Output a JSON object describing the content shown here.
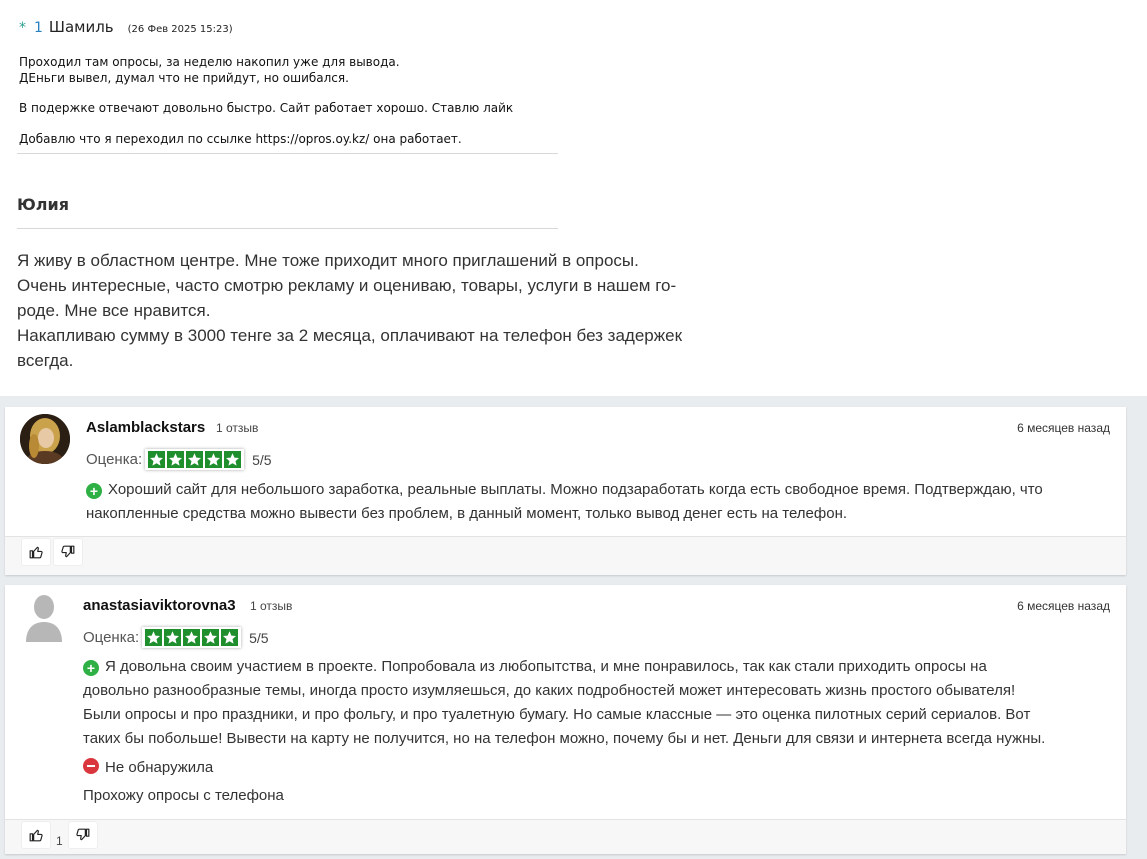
{
  "comment1": {
    "marker": "*",
    "number": "1",
    "author": "Шамиль",
    "date": "(26 Фев 2025 15:23)",
    "lines": [
      "Проходил там опросы, за неделю накопил уже для вывода.",
      "ДЕньги вывел, думал что не прийдут, но ошибался.",
      "В подержке отвечают довольно быстро. Сайт работает хорошо. Ставлю лайк",
      "Добавлю что я переходил по ссылке https://opros.oy.kz/ она работает."
    ]
  },
  "comment2": {
    "author": "Юлия",
    "lines": [
      "Я живу в областном центре. Мне тоже приходит много приглашений в опросы.",
      "Очень интересные, часто смотрю рекламу и оцениваю, товары, услуги в нашем го-",
      "роде. Мне все нравится.",
      "Накапливаю сумму в 3000 тенге за 2 месяца, оплачивают на телефон без задержек",
      "всегда."
    ]
  },
  "reviews": [
    {
      "username": "Aslamblackstars",
      "review_count": "1 отзыв",
      "time_ago": "6 месяцев назад",
      "rating_label": "Оценка:",
      "rating_value": 5,
      "rating_text": "5/5",
      "pros_lines": [
        "Хороший сайт для небольшого заработка, реальные выплаты. Можно подзаработать когда есть свободное время. Подтверждаю, что",
        "накопленные средства можно вывести без проблем, в данный момент, только вывод денег есть на телефон."
      ],
      "avatar": "user-photo"
    },
    {
      "username": "anastasiaviktorovna3",
      "review_count": "1 отзыв",
      "time_ago": "6 месяцев назад",
      "rating_label": "Оценка:",
      "rating_value": 5,
      "rating_text": "5/5",
      "pros_lines": [
        "Я довольна своим участием в проекте. Попробовала из любопытства, и мне понравилось, так как стали приходить опросы на",
        "довольно разнообразные темы, иногда просто изумляешься, до каких подробностей может интересовать жизнь простого обывателя!",
        "Были опросы и про праздники, и про фольгу, и про туалетную бумагу. Но самые классные — это оценка пилотных серий сериалов. Вот",
        "таких бы побольше! Вывести на карту не получится, но на телефон можно, почему бы и нет. Деньги для связи и интернета всегда нужны."
      ],
      "cons": "Не обнаружила",
      "extra": "Прохожу опросы с телефона",
      "upvotes": "1",
      "avatar": "default-user-silhouette"
    }
  ],
  "colors": {
    "star_green": "#1f8f2e",
    "plus_green": "#2eb044",
    "minus_red": "#d9363e",
    "band_gray": "#e9ecef"
  }
}
